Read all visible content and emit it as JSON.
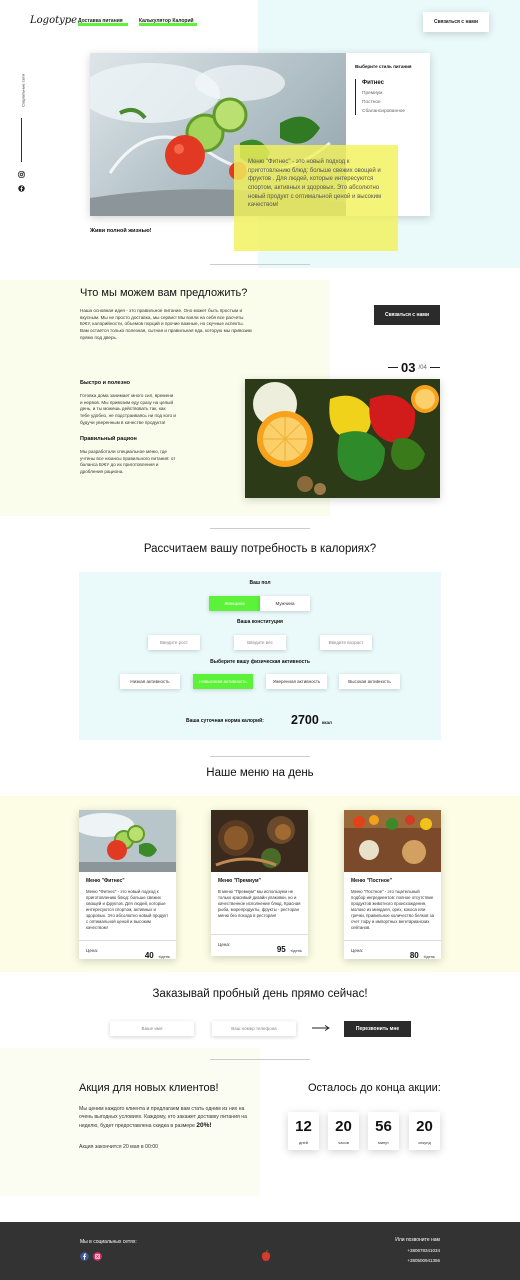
{
  "header": {
    "logo": "Logotype",
    "nav": [
      "Доставка питания",
      "Калькулятор Калорий"
    ],
    "contact_button": "Связаться с нами"
  },
  "side": {
    "social_label": "Социальные сети",
    "icons": [
      "instagram-icon",
      "facebook-icon"
    ]
  },
  "hero": {
    "style_title": "Выберите стиль питания",
    "styles": [
      "Фитнес",
      "Премиум",
      "Постное",
      "Сбалансированное"
    ],
    "selected_style": "Фитнес",
    "description": "Меню \"Фитнес\" - это новый подход к приготовлению блюд: больше свежих овощей и фруктов . Для людей, которые интересуются спортом, активных и здоровых. Это абсолютно новый продукт с оптимальной ценой и высоким качеством!",
    "slogan": "Живи полной жизнью!",
    "highlight_color": "#f2f25a"
  },
  "offer": {
    "title": "Что мы можем вам предложить?",
    "intro": "Наша основная идея - это правильное питание. Оно может быть простым и вкусным. Мы не просто доставка, мы сервис! Мы взяли на себя все расчеты БЖУ, калорийности, объемов порций и прочие важные, но скучные аспекты. Вам остается только полезная, сытная и правильная еда, которую мы привозим прямо под дверь.",
    "contact_button": "Связаться с нами",
    "counter_current": "03",
    "counter_total": "/04",
    "feature1_title": "Быстро и полезно",
    "feature1_text": "Готовка дома занимает много сил, времени и нервов. Мы привозим еду сразу на целый день, и ты можешь действовать так, как тебе удобно, не подстраиваясь ни под кого и будучи уверенным в качестве продукта!",
    "feature2_title": "Правильный рацион",
    "feature2_text": "Мы разработали специальное меню, где учтены все нюансы правильного питания: от баланса БЖУ до их приготовления и дробления рациона."
  },
  "calculator": {
    "title": "Рассчитаем вашу потребность в калориях?",
    "gender_label": "Ваш пол",
    "gender_options": [
      "Женщина",
      "Мужчина"
    ],
    "gender_selected": "Женщина",
    "constitution_label": "Ваша конституция",
    "placeholders": [
      "Введите рост",
      "Введите вес",
      "Введите возраст"
    ],
    "activity_label": "Выберите вашу физическая активность",
    "activity_options": [
      "Низкая активность",
      "Невысокая активность",
      "Умеренная активность",
      "Высокая активность"
    ],
    "activity_selected": "Невысокая активность",
    "result_label": "Ваша суточная норма калорий:",
    "result_value": "2700",
    "result_unit": "ккал",
    "accent_color": "#5cf23a"
  },
  "menu": {
    "title": "Наше меню на день",
    "price_label": "Цена:",
    "price_unit": "т/день",
    "cards": [
      {
        "title": "Меню \"Фитнес\"",
        "text": "Меню \"Фитнес\" - это новый подход к приготовлению блюд: больше свежих овощей и фруктов. Для людей, которые интересуются спортом, активных и здоровых. Это абсолютно новый продукт с оптимальной ценой и высоким качеством!",
        "price": "40"
      },
      {
        "title": "Меню \"Премиум\"",
        "text": "В меню \"Премиум\" мы используем не только красивый дизайн упаковки, но и качественное исполнение блюд. Красная рыба, морепродукты, фрукты - ресторан меню без похода в ресторан!",
        "price": "95"
      },
      {
        "title": "Меню \"Постное\"",
        "text": "Меню \"Постное\" - это тщательный подбор ингредиентов: полное отсутствие продуктов животного происхождения, молоко из миндаля, орех, кокоса или гречки, правильное количество белков за счет тофу и импортных вегетарианских сейтанов.",
        "price": "80"
      }
    ]
  },
  "trial": {
    "title": "Заказывай пробный день прямо сейчас!",
    "name_placeholder": "Ваше имя",
    "phone_placeholder": "Ваш номер телефона",
    "button": "Перезвонить мне"
  },
  "promo": {
    "title": "Акция для новых клиентов!",
    "text": "Мы ценим каждого клиента и предлагаем вам стать одним из них на очень выгодных условиях. Каждому, кто закажет доставку питания на неделю, будет предоставлена скидка в размере",
    "discount": "20%!",
    "ends": "Акция закончится 20 мая в 00:00",
    "countdown_title": "Осталось до конца акции:",
    "countdown": [
      {
        "value": "12",
        "label": "дней"
      },
      {
        "value": "20",
        "label": "часов"
      },
      {
        "value": "56",
        "label": "минут"
      },
      {
        "value": "20",
        "label": "секунд"
      }
    ]
  },
  "footer": {
    "social_label": "Мы в социальных сетях:",
    "call_label": "Или позвоните нам",
    "phones": [
      "+380678341034",
      "+380500941356"
    ]
  }
}
